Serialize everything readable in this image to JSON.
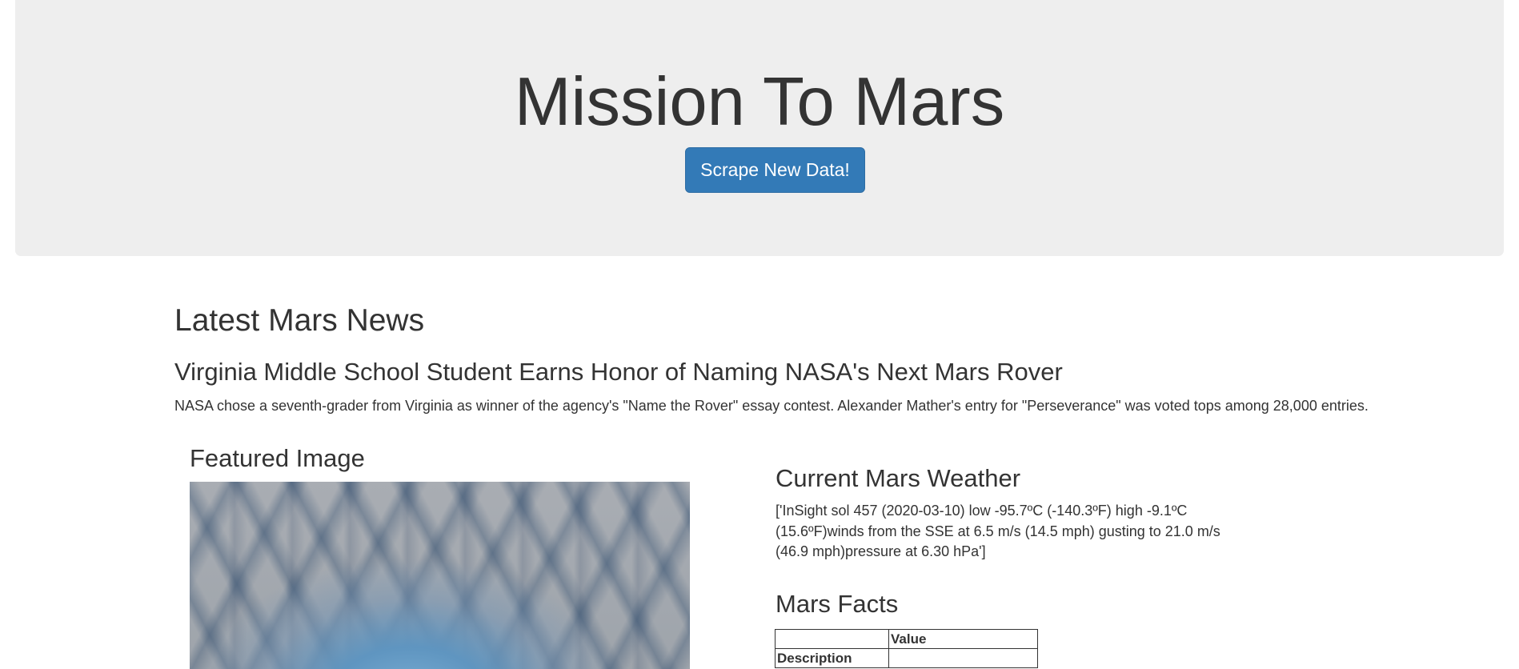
{
  "header": {
    "title": "Mission To Mars",
    "scrape_button_label": "Scrape New Data!",
    "scrape_button_color": "#337ab7"
  },
  "news": {
    "section_heading": "Latest Mars News",
    "title": "Virginia Middle School Student Earns Honor of Naming NASA's Next Mars Rover",
    "paragraph": "NASA chose a seventh-grader from Virginia as winner of the agency's \"Name the Rover\" essay contest. Alexander Mather's entry for \"Perseverance\" was voted tops among 28,000 entries."
  },
  "featured": {
    "heading": "Featured Image",
    "image_icon": "mars-crater-photo"
  },
  "weather": {
    "heading": "Current Mars Weather",
    "text": "['InSight sol 457 (2020-03-10) low -95.7ºC (-140.3ºF) high -9.1ºC (15.6ºF)winds from the SSE at 6.5 m/s (14.5 mph) gusting to 21.0 m/s (46.9 mph)pressure at 6.30 hPa']"
  },
  "facts": {
    "heading": "Mars Facts",
    "columns": [
      "",
      "Value"
    ],
    "rows": [
      {
        "label": "Description",
        "value": ""
      }
    ]
  }
}
